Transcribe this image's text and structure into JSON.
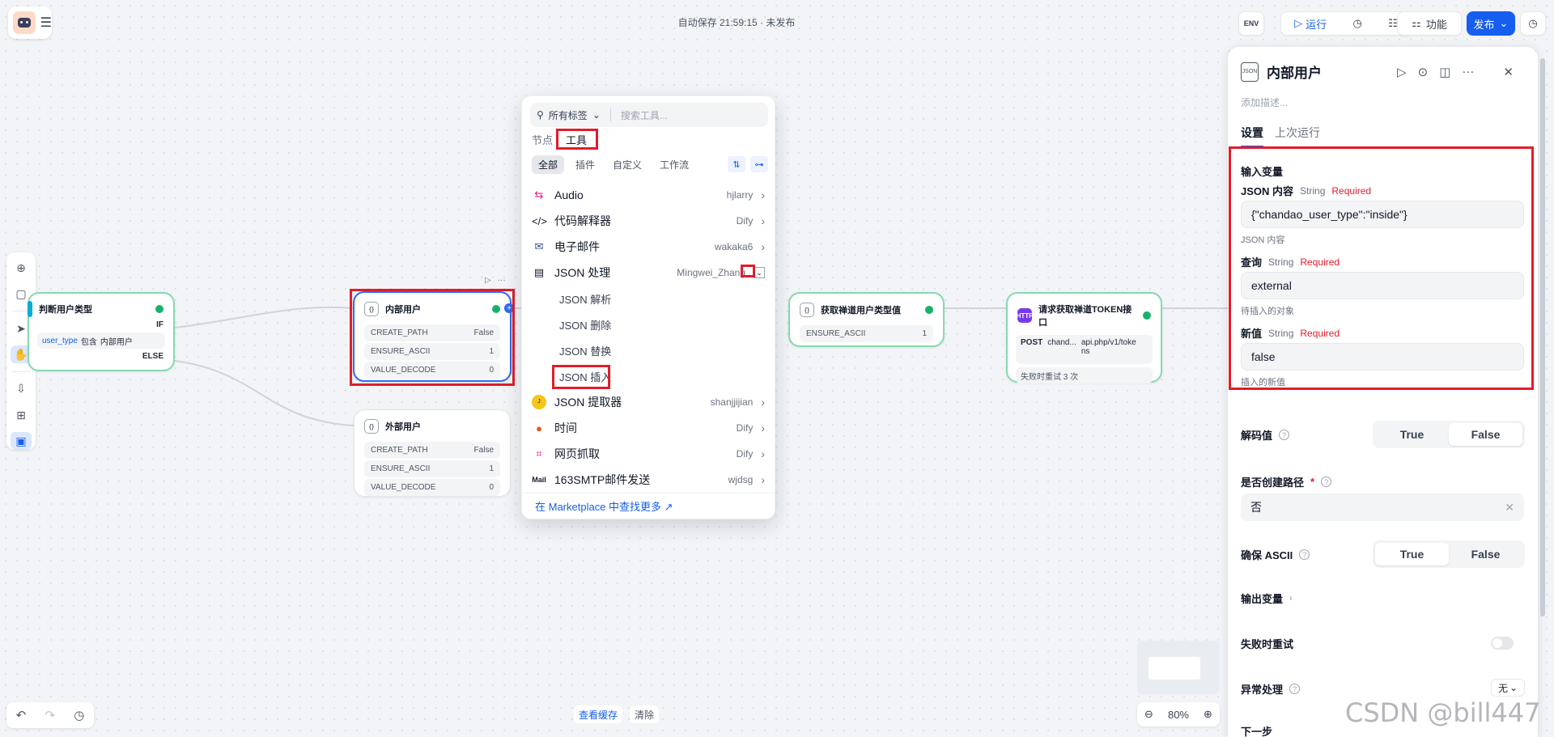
{
  "topbar": {
    "autosave": "自动保存 21:59:15 · 未发布",
    "env": "ENV",
    "run": "运行",
    "features": "功能",
    "publish": "发布"
  },
  "nodes": {
    "judge": {
      "title": "判断用户类型",
      "if": "IF",
      "cond_var": "user_type",
      "cond_op": "包含",
      "cond_val": "内部用户",
      "else": "ELSE"
    },
    "internal": {
      "title": "内部用户",
      "rows": [
        {
          "k": "CREATE_PATH",
          "v": "False"
        },
        {
          "k": "ENSURE_ASCII",
          "v": "1"
        },
        {
          "k": "VALUE_DECODE",
          "v": "0"
        }
      ]
    },
    "external": {
      "title": "外部用户",
      "rows": [
        {
          "k": "CREATE_PATH",
          "v": "False"
        },
        {
          "k": "ENSURE_ASCII",
          "v": "1"
        },
        {
          "k": "VALUE_DECODE",
          "v": "0"
        }
      ]
    },
    "get_type": {
      "title": "获取禅道用户类型值",
      "rows": [
        {
          "k": "ENSURE_ASCII",
          "v": "1"
        }
      ]
    },
    "token": {
      "title": "请求获取禅道TOKEN接口",
      "method": "POST",
      "url_prefix": "chand...",
      "url": "api.php/v1/tokens",
      "retry": "失败时重试 3 次"
    }
  },
  "popup": {
    "tag_filter": "所有标签",
    "search_placeholder": "搜索工具...",
    "tab_nodes": "节点",
    "tab_tools": "工具",
    "cats": [
      "全部",
      "插件",
      "自定义",
      "工作流"
    ],
    "items": [
      {
        "name": "Audio",
        "author": "hjlarry"
      },
      {
        "name": "代码解释器",
        "author": "Dify"
      },
      {
        "name": "电子邮件",
        "author": "wakaka6"
      },
      {
        "name": "JSON 处理",
        "author": "Mingwei_Zhang"
      }
    ],
    "sub_items": [
      "JSON 解析",
      "JSON 删除",
      "JSON 替换",
      "JSON 插入"
    ],
    "items2": [
      {
        "name": "JSON 提取器",
        "author": "shanjjijian"
      },
      {
        "name": "时间",
        "author": "Dify"
      },
      {
        "name": "网页抓取",
        "author": "Dify"
      },
      {
        "name": "163SMTP邮件发送",
        "author": "wjdsg"
      }
    ],
    "footer": "在 Marketplace 中查找更多 ↗"
  },
  "panel": {
    "title": "内部用户",
    "desc_placeholder": "添加描述...",
    "tab_settings": "设置",
    "tab_last_run": "上次运行",
    "input_vars": "输入变量",
    "json_content": {
      "label": "JSON 内容",
      "type": "String",
      "required": "Required",
      "value": "{\"chandao_user_type\":\"inside\"}",
      "hint": "JSON 内容"
    },
    "query": {
      "label": "查询",
      "type": "String",
      "required": "Required",
      "value": "external",
      "hint": "待插入的对象"
    },
    "new_value": {
      "label": "新值",
      "type": "String",
      "required": "Required",
      "value": "false",
      "hint": "插入的新值"
    },
    "decode": {
      "label": "解码值",
      "true": "True",
      "false": "False"
    },
    "create_path": {
      "label": "是否创建路径",
      "value": "否"
    },
    "ensure_ascii": {
      "label": "确保 ASCII",
      "true": "True",
      "false": "False"
    },
    "output_vars": "输出变量",
    "retry": "失败时重试",
    "exception": "异常处理",
    "exception_val": "无",
    "next_step": "下一步"
  },
  "bottom": {
    "view_cache": "查看缓存",
    "clear": "清除",
    "zoom": "80%"
  },
  "watermark": "CSDN @bill447"
}
